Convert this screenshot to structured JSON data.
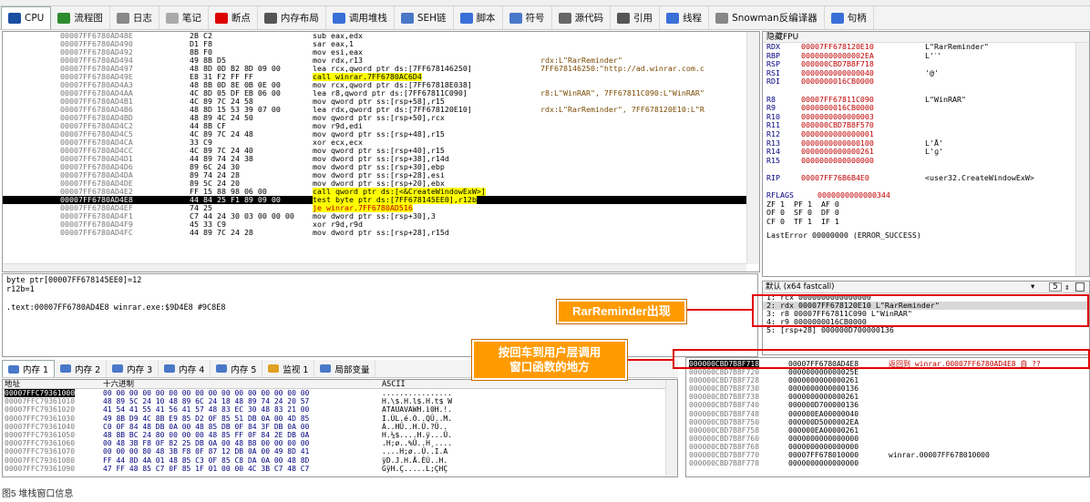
{
  "tabs": [
    {
      "label": "CPU",
      "icon": "cpu-icon"
    },
    {
      "label": "流程图",
      "icon": "graph-icon"
    },
    {
      "label": "日志",
      "icon": "log-icon"
    },
    {
      "label": "笔记",
      "icon": "notes-icon"
    },
    {
      "label": "断点",
      "icon": "breakpoint-icon"
    },
    {
      "label": "内存布局",
      "icon": "memory-map-icon"
    },
    {
      "label": "调用堆栈",
      "icon": "call-stack-icon"
    },
    {
      "label": "SEH链",
      "icon": "seh-icon"
    },
    {
      "label": "脚本",
      "icon": "script-icon"
    },
    {
      "label": "符号",
      "icon": "symbol-icon"
    },
    {
      "label": "源代码",
      "icon": "source-icon"
    },
    {
      "label": "引用",
      "icon": "search-icon"
    },
    {
      "label": "线程",
      "icon": "thread-icon"
    },
    {
      "label": "Snowman反编译器",
      "icon": "snowman-icon"
    },
    {
      "label": "句柄",
      "icon": "handle-icon"
    }
  ],
  "disasm": [
    {
      "addr": "00007FF6780AD48E",
      "bytes": "2B C2",
      "asm": "sub eax,edx",
      "cmt": ""
    },
    {
      "addr": "00007FF6780AD490",
      "bytes": "D1 F8",
      "asm": "sar eax,1",
      "cmt": ""
    },
    {
      "addr": "00007FF6780AD492",
      "bytes": "8B F0",
      "asm": "mov esi,eax",
      "cmt": ""
    },
    {
      "addr": "00007FF6780AD494",
      "bytes": "49 8B D5",
      "asm": "mov rdx,r13",
      "cmt": "rdx:L\"RarReminder\""
    },
    {
      "addr": "00007FF6780AD497",
      "bytes": "48 8D 0D B2 8D 09 00",
      "asm": "lea rcx,qword ptr ds:[7FF678146250]",
      "cmt": "7FF678146250:\"http://ad.winrar.com.c"
    },
    {
      "addr": "00007FF6780AD49E",
      "bytes": "E8 31 F2 FF FF",
      "asm": "call winrar.7FF6780AC6D4",
      "cmt": ""
    },
    {
      "addr": "00007FF6780AD4A3",
      "bytes": "48 8B 0D 8E 0B 0E 00",
      "asm": "mov rcx,qword ptr ds:[7FF67818E038]",
      "cmt": ""
    },
    {
      "addr": "00007FF6780AD4AA",
      "bytes": "4C 8D 05 DF EB 06 00",
      "asm": "lea r8,qword ptr ds:[7FF67811C090]",
      "cmt": "r8:L\"WinRAR\", 7FF67811C090:L\"WinRAR\""
    },
    {
      "addr": "00007FF6780AD4B1",
      "bytes": "4C 89 7C 24 58",
      "asm": "mov qword ptr ss:[rsp+58],r15",
      "cmt": ""
    },
    {
      "addr": "00007FF6780AD4B6",
      "bytes": "48 8D 15 53 39 07 00",
      "asm": "lea rdx,qword ptr ds:[7FF678120E10]",
      "cmt": "rdx:L\"RarReminder\", 7FF678120E10:L\"R"
    },
    {
      "addr": "00007FF6780AD4BD",
      "bytes": "48 89 4C 24 50",
      "asm": "mov qword ptr ss:[rsp+50],rcx",
      "cmt": ""
    },
    {
      "addr": "00007FF6780AD4C2",
      "bytes": "44 8B CF",
      "asm": "mov r9d,edi",
      "cmt": ""
    },
    {
      "addr": "00007FF6780AD4C5",
      "bytes": "4C 89 7C 24 48",
      "asm": "mov qword ptr ss:[rsp+48],r15",
      "cmt": ""
    },
    {
      "addr": "00007FF6780AD4CA",
      "bytes": "33 C9",
      "asm": "xor ecx,ecx",
      "cmt": ""
    },
    {
      "addr": "00007FF6780AD4CC",
      "bytes": "4C 89 7C 24 40",
      "asm": "mov qword ptr ss:[rsp+40],r15",
      "cmt": ""
    },
    {
      "addr": "00007FF6780AD4D1",
      "bytes": "44 89 74 24 38",
      "asm": "mov dword ptr ss:[rsp+38],r14d",
      "cmt": ""
    },
    {
      "addr": "00007FF6780AD4D6",
      "bytes": "89 6C 24 30",
      "asm": "mov dword ptr ss:[rsp+30],ebp",
      "cmt": ""
    },
    {
      "addr": "00007FF6780AD4DA",
      "bytes": "89 74 24 28",
      "asm": "mov dword ptr ss:[rsp+28],esi",
      "cmt": ""
    },
    {
      "addr": "00007FF6780AD4DE",
      "bytes": "89 5C 24 20",
      "asm": "mov dword ptr ss:[rsp+20],ebx",
      "cmt": ""
    },
    {
      "addr": "00007FF6780AD4E2",
      "bytes": "FF 15 88 98 06 00",
      "asm": "call qword ptr ds:[<&CreateWindowExW>]",
      "cmt": ""
    },
    {
      "addr": "00007FF6780AD4E8",
      "bytes": "44 84 25 F1 89 09 00",
      "asm": "test byte ptr ds:[7FF678145EE0],r12b",
      "cmt": ""
    },
    {
      "addr": "00007FF6780AD4EF",
      "bytes": "74 25",
      "asm": "je winrar.7FF6780AD516",
      "cmt": ""
    },
    {
      "addr": "00007FF6780AD4F1",
      "bytes": "C7 44 24 30 03 00 00 00",
      "asm": "mov dword ptr ss:[rsp+30],3",
      "cmt": ""
    },
    {
      "addr": "00007FF6780AD4F9",
      "bytes": "45 33 C9",
      "asm": "xor r9d,r9d",
      "cmt": ""
    },
    {
      "addr": "00007FF6780AD4FC",
      "bytes": "44 89 7C 24 28",
      "asm": "mov dword ptr ss:[rsp+28],r15d",
      "cmt": ""
    }
  ],
  "regs_header": "隐藏FPU",
  "regs": [
    {
      "n": "RDX",
      "v": "00007FF678120E10",
      "c": "L\"RarReminder\""
    },
    {
      "n": "RBP",
      "v": "00000000000002EA",
      "c": "L'ˊ'"
    },
    {
      "n": "RSP",
      "v": "000000CBD7B8F718",
      "c": ""
    },
    {
      "n": "RSI",
      "v": "0000000000000040",
      "c": "'@'"
    },
    {
      "n": "RDI",
      "v": "0000000016CB0000",
      "c": ""
    },
    {
      "n": "",
      "v": "",
      "c": ""
    },
    {
      "n": "R8",
      "v": "00007FF67811C090",
      "c": "L\"WinRAR\""
    },
    {
      "n": "R9",
      "v": "0000000016CB0000",
      "c": ""
    },
    {
      "n": "R10",
      "v": "0000000000000003",
      "c": ""
    },
    {
      "n": "R11",
      "v": "000000CBD7B8F570",
      "c": ""
    },
    {
      "n": "R12",
      "v": "0000000000000001",
      "c": ""
    },
    {
      "n": "R13",
      "v": "0000000000000100",
      "c": "L'Ā'"
    },
    {
      "n": "R14",
      "v": "0000000000000261",
      "c": "L'ɡ'"
    },
    {
      "n": "R15",
      "v": "0000000000000000",
      "c": ""
    },
    {
      "n": "",
      "v": "",
      "c": ""
    },
    {
      "n": "RIP",
      "v": "00007FF76B6B4E0",
      "c": "<user32.CreateWindowExW>"
    },
    {
      "n": "",
      "v": "",
      "c": ""
    },
    {
      "n": "RFLAGS",
      "v": "0000000000000344",
      "c": ""
    }
  ],
  "flags": [
    "ZF 1  PF 1  AF 0",
    "OF 0  SF 0  DF 0",
    "CF 0  TF 1  IF 1"
  ],
  "last_error": "LastError 00000000 (ERROR_SUCCESS)",
  "info_lines": [
    "byte ptr[00007FF678145EE0]=12",
    "r12b=1",
    "",
    ".text:00007FF6780AD4E8 winrar.exe:$9D4E8 #9C8E8"
  ],
  "callconv": {
    "label": "默认 (x64 fastcall)",
    "count": "5",
    "args": [
      "1: rcx 0000000000000000",
      "2: rdx 00007FF678120E10 L\"RarReminder\"",
      "3: r8 00007FF67811C090 L\"WinRAR\"",
      "4: r9 0000000016CB0000",
      "5: [rsp+28] 000000D700000136"
    ]
  },
  "dump_tabs": [
    "内存 1",
    "内存 2",
    "内存 3",
    "内存 4",
    "内存 5",
    "监视 1",
    "局部变量"
  ],
  "dump_header": {
    "addr": "地址",
    "hex": "十六进制",
    "ascii": "ASCII"
  },
  "dump": [
    {
      "a": "00007FFC79361000",
      "h": "00 00 00 00 00 00 00 00 00 00 00 00 00 00 00 00",
      "c": "................"
    },
    {
      "a": "00007FFC79361010",
      "h": "48 89 5C 24 10 48 89 6C 24 18 48 89 74 24 20 57",
      "c": "H.\\$.H.l$.H.t$ W"
    },
    {
      "a": "00007FFC79361020",
      "h": "41 54 41 55 41 56 41 57 48 83 EC 30 48 83 21 00",
      "c": "ATAUAVAWH.ì0H.!."
    },
    {
      "a": "00007FFC79361030",
      "h": "49 8B D9 4C 8B E9 85 D2 0F 85 51 DB 0A 00 4D 85",
      "c": "I.ÙL.é.Ò..QÛ..M."
    },
    {
      "a": "00007FFC79361040",
      "h": "C0 0F 84 48 DB 0A 00 48 85 DB 0F 84 3F DB 0A 00",
      "c": "À..HÛ..H.Û.?Û.."
    },
    {
      "a": "00007FFC79361050",
      "h": "48 8B BC 24 80 00 00 00 48 85 FF 0F 84 2E DB 0A",
      "c": "H.¼$....H.ÿ...Û."
    },
    {
      "a": "00007FFC79361060",
      "h": "00 48 3B F8 0F 82 25 DB 0A 00 48 B8 00 00 00 00",
      "c": ".H;ø..%Û..H¸...."
    },
    {
      "a": "00007FFC79361070",
      "h": "00 00 00 80 48 3B F8 0F 87 12 DB 0A 00 49 8D 41",
      "c": "....H;ø..Û..I.A"
    },
    {
      "a": "00007FFC79361080",
      "h": "FF 44 8D 4A 01 48 85 C3 0F 85 C8 DA 0A 00 48 8D",
      "c": "ÿD.J.H.Ã.ÈÚ..H."
    },
    {
      "a": "00007FFC79361090",
      "h": "47 FF 48 85 C7 0F 85 1F 01 00 00 4C 3B C7 48 C7",
      "c": "GÿH.Ç.....L;ÇHÇ"
    }
  ],
  "stack": [
    {
      "a": "000000CBD7B8F718",
      "v": "00007FF6780AD4E8",
      "c": "返回到 winrar.00007FF6780AD4E8 自 ??"
    },
    {
      "a": "000000CBD7B8F720",
      "v": "000000000000025E",
      "c": ""
    },
    {
      "a": "000000CBD7B8F728",
      "v": "0000000000000261",
      "c": ""
    },
    {
      "a": "000000CBD7B8F730",
      "v": "0000000000000136",
      "c": ""
    },
    {
      "a": "000000CBD7B8F738",
      "v": "0000000000000261",
      "c": ""
    },
    {
      "a": "000000CBD7B8F740",
      "v": "000000D700000136",
      "c": ""
    },
    {
      "a": "000000CBD7B8F748",
      "v": "000000EA00000040",
      "c": ""
    },
    {
      "a": "000000CBD7B8F750",
      "v": "000000D5000002EA",
      "c": ""
    },
    {
      "a": "000000CBD7B8F758",
      "v": "000000EA00000261",
      "c": ""
    },
    {
      "a": "000000CBD7B8F760",
      "v": "0000000000000000",
      "c": ""
    },
    {
      "a": "000000CBD7B8F768",
      "v": "0000000000000000",
      "c": ""
    },
    {
      "a": "000000CBD7B8F770",
      "v": "00007FF678010000",
      "c": "winrar.00007FF678010000"
    },
    {
      "a": "000000CBD7B8F778",
      "v": "0000000000000000",
      "c": ""
    }
  ],
  "annotations": {
    "rar": "RarReminder出现",
    "ret": "按回车到用户层调用\n窗口函数的地方"
  },
  "caption": "图5 堆栈窗口信息"
}
